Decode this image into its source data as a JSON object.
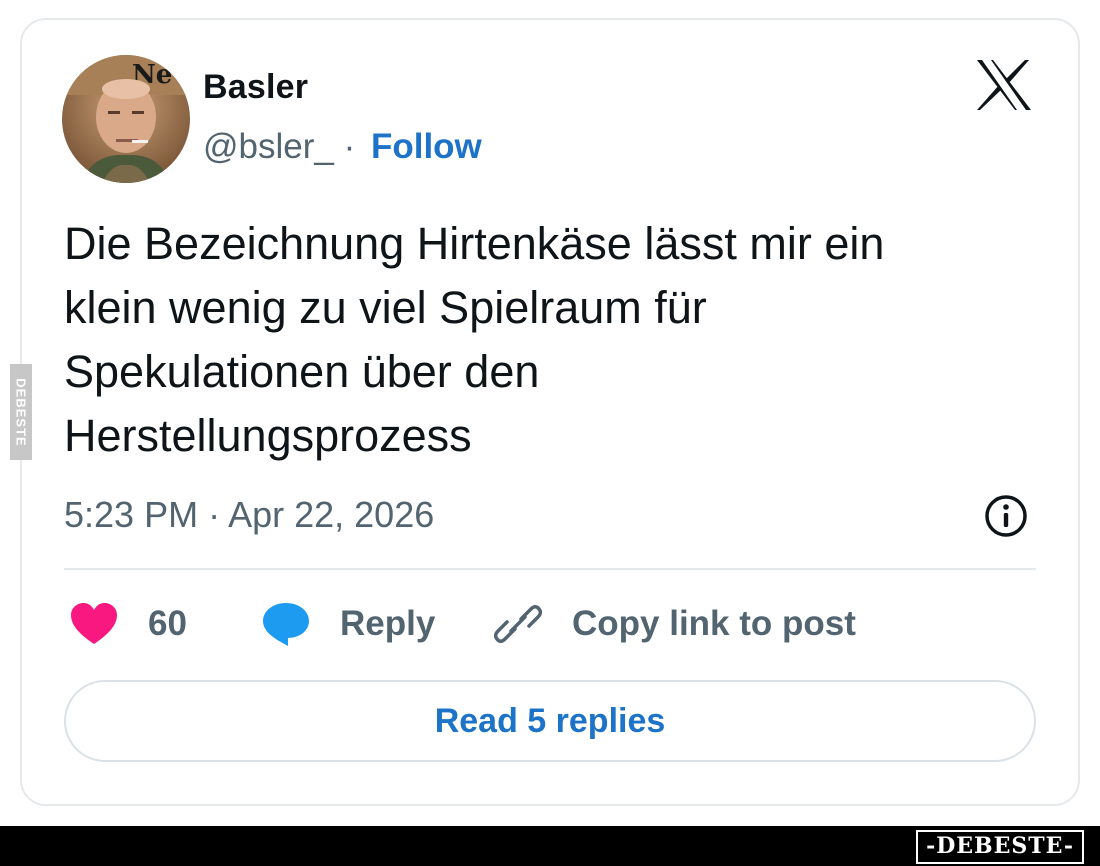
{
  "post": {
    "author": {
      "name": "Basler",
      "handle": "@bsler_",
      "separator": " · ",
      "follow_label": "Follow"
    },
    "platform_icon": "x-logo-icon",
    "text_lines": [
      "Die Bezeichnung Hirtenkäse lässt mir ein",
      "klein wenig zu viel Spielraum für",
      "Spekulationen über den",
      "Herstellungsprozess"
    ],
    "timestamp": "5:23 PM · Apr 22, 2026",
    "info_icon": "info-icon",
    "actions": {
      "like_count": "60",
      "reply_label": "Reply",
      "copy_label": "Copy link to post"
    },
    "read_replies_label": "Read 5 replies"
  },
  "watermark": {
    "side_text": "DEBESTE",
    "footer_text": "-DEBESTE-"
  },
  "colors": {
    "text_primary": "#0f1419",
    "text_secondary": "#536471",
    "link_blue": "#1d73c7",
    "like_pink": "#f91880",
    "reply_blue": "#1d9bf0",
    "border": "#e6e9ec"
  }
}
